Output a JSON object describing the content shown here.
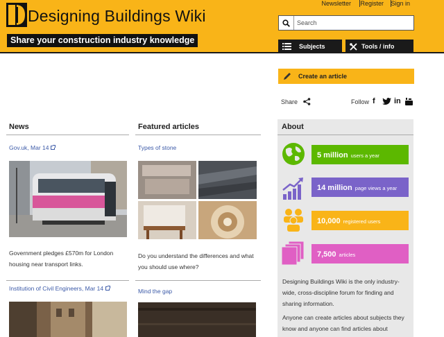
{
  "site": {
    "title": "Designing Buildings Wiki",
    "tagline": "Share your construction industry knowledge"
  },
  "top_links": [
    "Newsletter",
    "Register",
    "Sign in"
  ],
  "search": {
    "placeholder": "Search"
  },
  "nav": {
    "subjects": "Subjects",
    "tools": "Tools / info"
  },
  "create_article": "Create an article",
  "share": {
    "share_label": "Share",
    "follow_label": "Follow",
    "social": [
      "facebook-icon",
      "twitter-icon",
      "linkedin-icon",
      "youtube-icon"
    ]
  },
  "news": {
    "heading": "News",
    "items": [
      {
        "source": "Gov.uk, Mar 14",
        "text": "Government pledges £570m for London housing near transport links."
      },
      {
        "source": "Institution of Civil Engineers, Mar 14",
        "text": ""
      }
    ]
  },
  "featured": {
    "heading": "Featured articles",
    "items": [
      {
        "title": "Types of stone",
        "text": "Do you understand the differences and what you should use where?"
      },
      {
        "title": "Mind the gap",
        "text": ""
      }
    ]
  },
  "about": {
    "heading": "About",
    "stats": [
      {
        "number": "5 million",
        "label": "users a year",
        "color": "#5cb800",
        "icon": "globe-icon"
      },
      {
        "number": "14 million",
        "label": "page views a year",
        "color": "#7a63c9",
        "icon": "growth-chart-icon"
      },
      {
        "number": "10,000",
        "label": "registered users",
        "color": "#f9b418",
        "icon": "users-icon"
      },
      {
        "number": "7,500",
        "label": "articles",
        "color": "#e05fc4",
        "icon": "pages-icon"
      }
    ],
    "para1": "Designing Buildings Wiki is the only industry-wide, cross-discipline forum for finding and sharing information.",
    "para2": "Anyone can create articles about subjects they know and anyone can find articles about subjects they don't."
  },
  "colors": {
    "brand_yellow": "#f9b418",
    "header_black": "#1a1a1a",
    "link_blue": "#3c5aa8"
  }
}
